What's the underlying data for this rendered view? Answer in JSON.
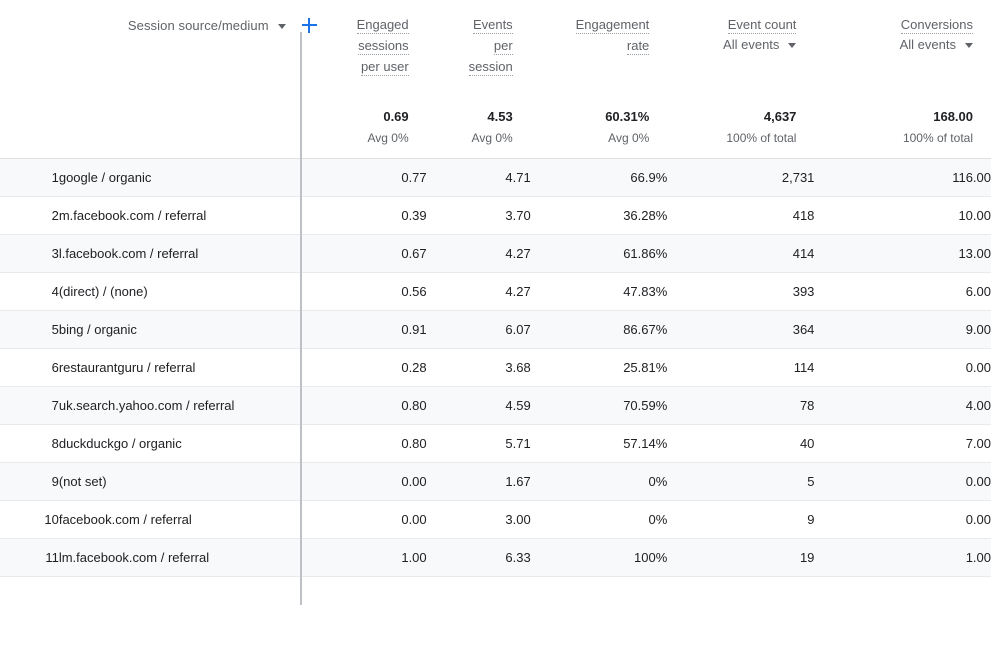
{
  "dimension_header": {
    "label": "Session source/medium",
    "dropdown_icon": "chevron-down-icon",
    "add_icon": "plus-icon"
  },
  "columns": [
    {
      "id": "engaged_sessions_per_user",
      "lines": [
        "Engaged",
        "sessions",
        "per user"
      ],
      "sub": null
    },
    {
      "id": "events_per_session",
      "lines": [
        "Events",
        "per",
        "session"
      ],
      "sub": null
    },
    {
      "id": "engagement_rate",
      "lines": [
        "Engagement",
        "rate"
      ],
      "sub": null
    },
    {
      "id": "event_count",
      "lines": [
        "Event count"
      ],
      "sub": "All events"
    },
    {
      "id": "conversions",
      "lines": [
        "Conversions"
      ],
      "sub": "All events"
    }
  ],
  "summary": {
    "engaged_sessions_per_user": {
      "value": "0.69",
      "note": "Avg 0%"
    },
    "events_per_session": {
      "value": "4.53",
      "note": "Avg 0%"
    },
    "engagement_rate": {
      "value": "60.31%",
      "note": "Avg 0%"
    },
    "event_count": {
      "value": "4,637",
      "note": "100% of total"
    },
    "conversions": {
      "value": "168.00",
      "note": "100% of total"
    }
  },
  "rows": [
    {
      "index": "1",
      "dimension": "google / organic",
      "engaged_sessions_per_user": "0.77",
      "events_per_session": "4.71",
      "engagement_rate": "66.9%",
      "event_count": "2,731",
      "conversions": "116.00"
    },
    {
      "index": "2",
      "dimension": "m.facebook.com / referral",
      "engaged_sessions_per_user": "0.39",
      "events_per_session": "3.70",
      "engagement_rate": "36.28%",
      "event_count": "418",
      "conversions": "10.00"
    },
    {
      "index": "3",
      "dimension": "l.facebook.com / referral",
      "engaged_sessions_per_user": "0.67",
      "events_per_session": "4.27",
      "engagement_rate": "61.86%",
      "event_count": "414",
      "conversions": "13.00"
    },
    {
      "index": "4",
      "dimension": "(direct) / (none)",
      "engaged_sessions_per_user": "0.56",
      "events_per_session": "4.27",
      "engagement_rate": "47.83%",
      "event_count": "393",
      "conversions": "6.00"
    },
    {
      "index": "5",
      "dimension": "bing / organic",
      "engaged_sessions_per_user": "0.91",
      "events_per_session": "6.07",
      "engagement_rate": "86.67%",
      "event_count": "364",
      "conversions": "9.00"
    },
    {
      "index": "6",
      "dimension": "restaurantguru / referral",
      "engaged_sessions_per_user": "0.28",
      "events_per_session": "3.68",
      "engagement_rate": "25.81%",
      "event_count": "114",
      "conversions": "0.00"
    },
    {
      "index": "7",
      "dimension": "uk.search.yahoo.com / referral",
      "engaged_sessions_per_user": "0.80",
      "events_per_session": "4.59",
      "engagement_rate": "70.59%",
      "event_count": "78",
      "conversions": "4.00"
    },
    {
      "index": "8",
      "dimension": "duckduckgo / organic",
      "engaged_sessions_per_user": "0.80",
      "events_per_session": "5.71",
      "engagement_rate": "57.14%",
      "event_count": "40",
      "conversions": "7.00"
    },
    {
      "index": "9",
      "dimension": "(not set)",
      "engaged_sessions_per_user": "0.00",
      "events_per_session": "1.67",
      "engagement_rate": "0%",
      "event_count": "5",
      "conversions": "0.00"
    },
    {
      "index": "10",
      "dimension": "facebook.com / referral",
      "engaged_sessions_per_user": "0.00",
      "events_per_session": "3.00",
      "engagement_rate": "0%",
      "event_count": "9",
      "conversions": "0.00"
    },
    {
      "index": "11",
      "dimension": "lm.facebook.com / referral",
      "engaged_sessions_per_user": "1.00",
      "events_per_session": "6.33",
      "engagement_rate": "100%",
      "event_count": "19",
      "conversions": "1.00"
    }
  ],
  "colors": {
    "accent": "#1a73e8",
    "text_primary": "#202124",
    "text_secondary": "#5f6368",
    "row_alt": "#f8f9fa",
    "border": "#e8eaed",
    "divider": "#bdc1c6"
  }
}
